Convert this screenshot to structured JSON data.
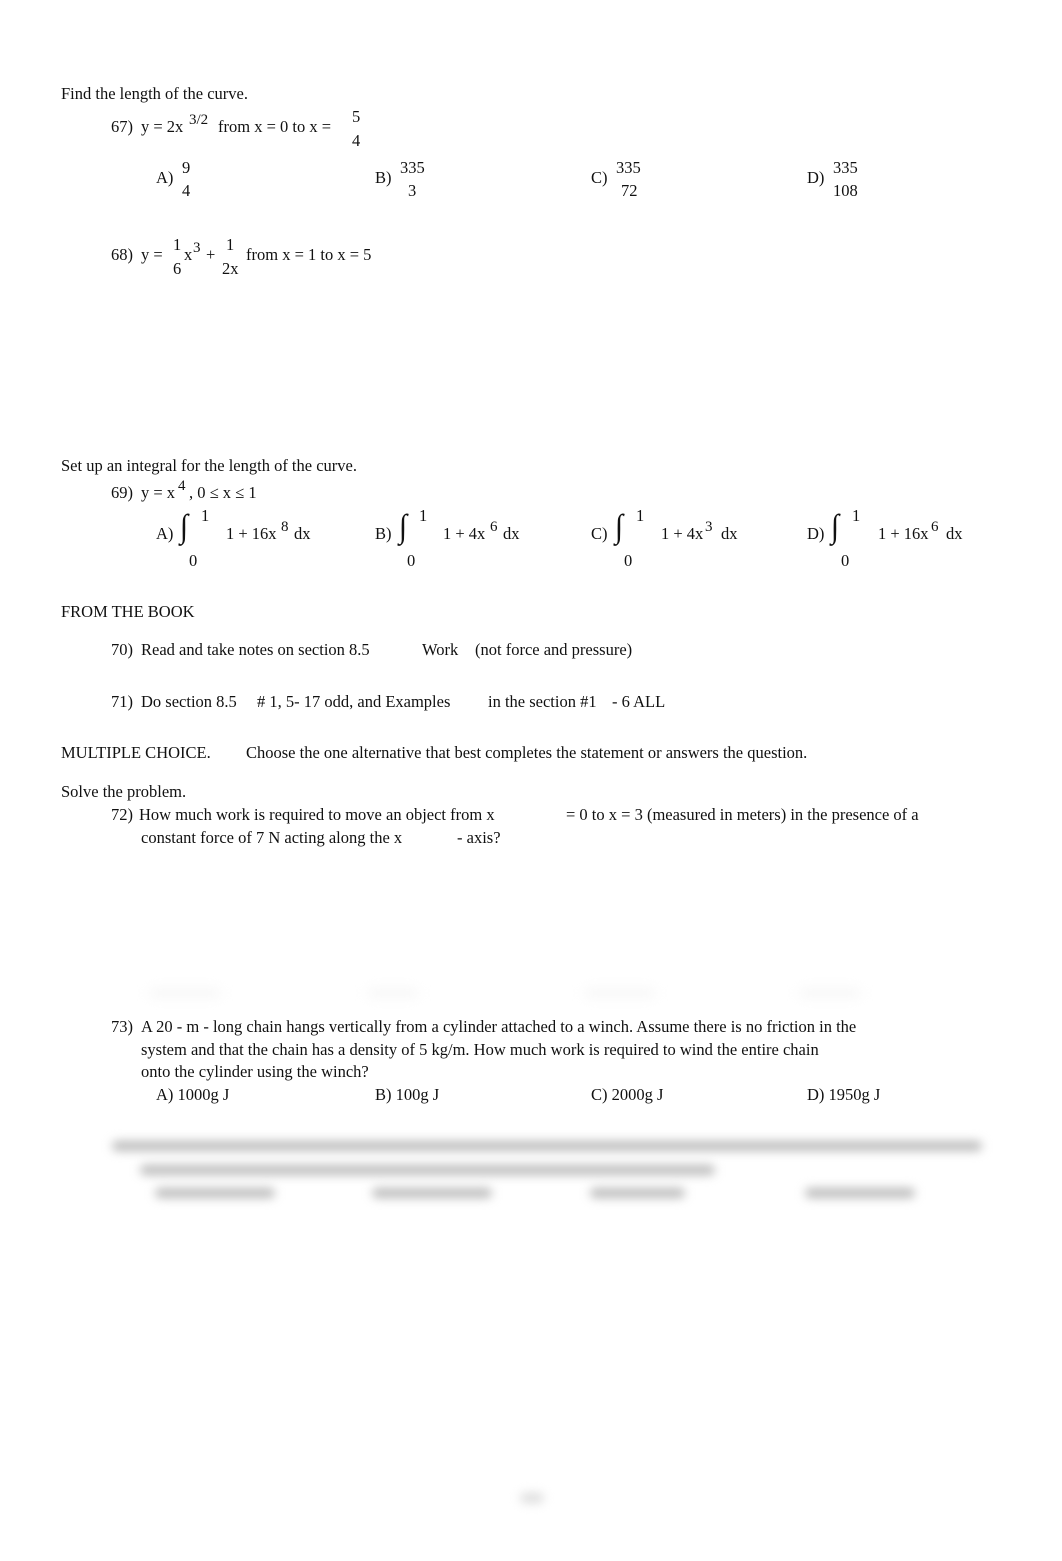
{
  "sec1": {
    "instruction": "Find the length of the curve."
  },
  "q67": {
    "num": "67)",
    "lhs": "y  = 2x",
    "exp": "3/2",
    "mid": "from x  = 0 to x =",
    "fnum": "5",
    "fden": "4",
    "choices": [
      {
        "label": "A)",
        "num": "9",
        "den": "4"
      },
      {
        "label": "B)",
        "num": "335",
        "den": "3"
      },
      {
        "label": "C)",
        "num": "335",
        "den": "72"
      },
      {
        "label": "D)",
        "num": "335",
        "den": "108"
      }
    ]
  },
  "q68": {
    "num": "68)",
    "y": "y  =",
    "f1n": "1",
    "f1d": "6",
    "x3": "x",
    "e3": "3",
    "plus": "+",
    "f2n": "1",
    "f2d": "2x",
    "rest": "from x  = 1 to x = 5"
  },
  "sec2": {
    "instruction": "Set up an integral for the length of the curve."
  },
  "q69": {
    "num": "69)",
    "lhs": "y  = x",
    "exp": "4",
    "rest": ", 0 ≤ x ≤ 1",
    "choices": [
      {
        "label": "A)",
        "upper": "1",
        "lower": "0",
        "a": "1 + 16x",
        "e": "8",
        "b": "dx"
      },
      {
        "label": "B)",
        "upper": "1",
        "lower": "0",
        "a": "1 + 4x",
        "e": "6",
        "b": "dx"
      },
      {
        "label": "C)",
        "upper": "1",
        "lower": "0",
        "a": "1 + 4x",
        "e": "3",
        "b": "dx"
      },
      {
        "label": "D)",
        "upper": "1",
        "lower": "0",
        "a": "1 + 16x",
        "e": "6",
        "b": "dx"
      }
    ]
  },
  "book": {
    "heading": "FROM THE BOOK",
    "q70": {
      "num": "70)",
      "a": "Read and take notes on section 8.5",
      "b": "Work",
      "c": "(not force and pressure)"
    },
    "q71": {
      "num": "71)",
      "a": "Do section 8.5",
      "b": "# 1, 5- 17 odd, and Examples",
      "c": "in the section #1",
      "d": "- 6 ALL"
    }
  },
  "mc": {
    "heading": "MULTIPLE CHOICE.",
    "text": "Choose the one alternative that best completes the statement or answers the question."
  },
  "sec3": {
    "instruction": "Solve the problem."
  },
  "q72": {
    "num": "72)",
    "l1a": "How much work is required to move an object from x",
    "l1b": "= 0 to x  = 3 (measured in meters) in the presence of a",
    "l2a": "constant force of 7 N acting along the x",
    "l2b": "- axis?"
  },
  "q73": {
    "num": "73)",
    "l1": "A 20 - m - long chain hangs vertically from a cylinder attached to a winch. Assume there is no friction in the",
    "l2": "system and that the chain has a density of 5 kg/m. How much work is required to wind the entire chain",
    "l3": "onto the cylinder using the winch?",
    "choices": [
      {
        "label": "A)",
        "text": "1000g J"
      },
      {
        "label": "B)",
        "text": "100g J"
      },
      {
        "label": "C)",
        "text": "2000g J"
      },
      {
        "label": "D)",
        "text": "1950g J"
      }
    ]
  }
}
